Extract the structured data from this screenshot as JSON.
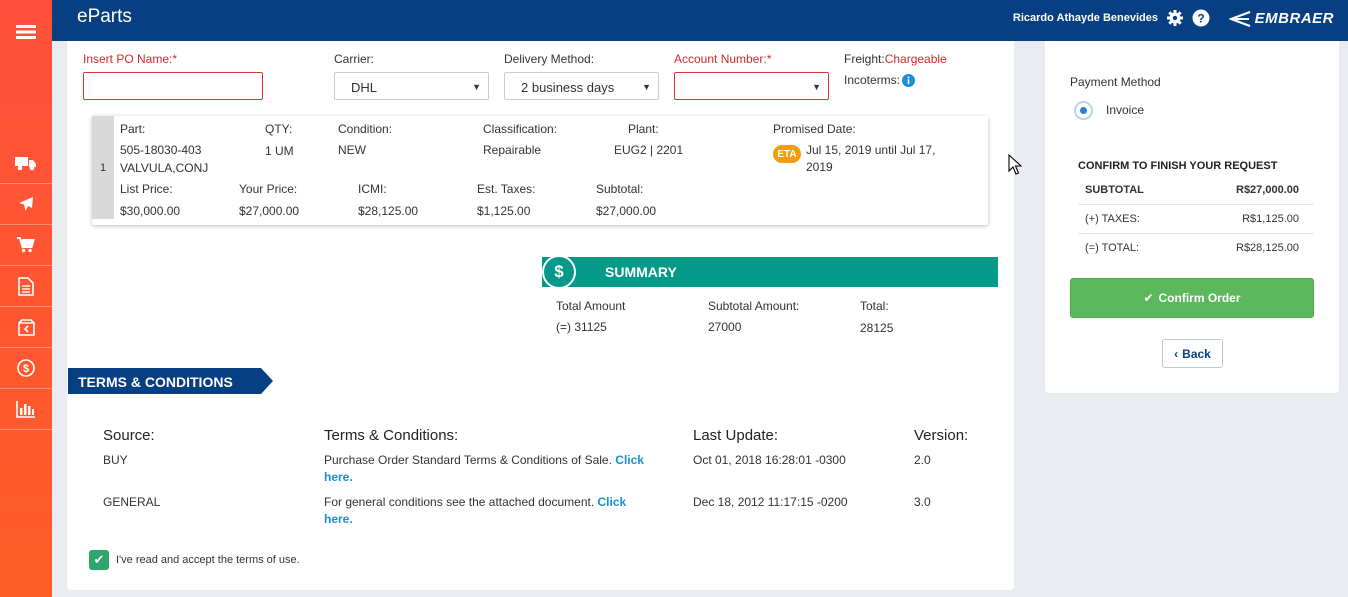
{
  "header": {
    "brand": "eParts",
    "user_name": "Ricardo Athayde Benevides",
    "logo_text": "EMBRAER",
    "icons": [
      "gear-icon",
      "help-icon"
    ]
  },
  "sidebar": {
    "items": [
      {
        "icon": "menu-icon"
      },
      {
        "icon": "truck-icon"
      },
      {
        "icon": "airplane-icon"
      },
      {
        "icon": "cart-icon"
      },
      {
        "icon": "document-icon"
      },
      {
        "icon": "return-box-icon"
      },
      {
        "icon": "dollar-cycle-icon"
      },
      {
        "icon": "bar-chart-icon"
      }
    ]
  },
  "form": {
    "po_name_label": "Insert PO Name:",
    "required_mark": "*",
    "po_name_value": "",
    "carrier_label": "Carrier:",
    "carrier_value": "DHL",
    "delivery_label": "Delivery Method:",
    "delivery_value": "2 business days",
    "account_label": "Account Number:",
    "account_value": "",
    "freight_label": "Freight:",
    "freight_value": "Chargeable",
    "incoterms_label": "Incoterms:"
  },
  "part": {
    "index": "1",
    "part_label": "Part:",
    "part_number": "505-18030-403",
    "part_name": "VALVULA,CONJ",
    "qty_label": "QTY:",
    "qty_value": "1 UM",
    "condition_label": "Condition:",
    "condition_value": "NEW",
    "classification_label": "Classification:",
    "classification_value": "Repairable",
    "plant_label": "Plant:",
    "plant_value": "EUG2 | 2201",
    "promised_label": "Promised Date:",
    "eta_badge": "ETA",
    "promised_line1": "Jul 15, 2019 until Jul 17,",
    "promised_line2": "2019",
    "list_price_label": "List Price:",
    "list_price_value": "$30,000.00",
    "your_price_label": "Your Price:",
    "your_price_value": "$27,000.00",
    "icmi_label": "ICMI:",
    "icmi_value": "$28,125.00",
    "taxes_label": "Est. Taxes:",
    "taxes_value": "$1,125.00",
    "subtotal_label": "Subtotal:",
    "subtotal_value": "$27,000.00"
  },
  "summary": {
    "icon_symbol": "$",
    "title": "SUMMARY",
    "total_amount_label": "Total Amount",
    "total_amount_value": "(=) 31125",
    "subtotal_amount_label": "Subtotal Amount:",
    "subtotal_amount_value": "27000",
    "total_label": "Total:",
    "total_value": "28125"
  },
  "terms": {
    "title": "TERMS & CONDITIONS",
    "headers": {
      "source": "Source:",
      "terms": "Terms & Conditions:",
      "last_update": "Last Update:",
      "version": "Version:"
    },
    "rows": [
      {
        "source": "BUY",
        "text": "Purchase Order Standard Terms & Conditions of Sale.",
        "link1": "Click",
        "link2": "here.",
        "updated": "Oct 01, 2018 16:28:01 -0300",
        "version": "2.0"
      },
      {
        "source": "GENERAL",
        "text": "For general conditions see the attached document.",
        "link1": "Click",
        "link2": "here.",
        "updated": "Dec 18, 2012 11:17:15 -0200",
        "version": "3.0"
      }
    ],
    "accept_label": "I've read and accept the terms of use.",
    "accepted": true
  },
  "checkout": {
    "payment_method_label": "Payment Method",
    "payment_option": "Invoice",
    "confirm_title": "CONFIRM TO FINISH YOUR REQUEST",
    "subtotal_label": "SUBTOTAL",
    "subtotal_value": "R$27,000.00",
    "taxes_label": "(+) TAXES:",
    "taxes_value": "R$1,125.00",
    "total_label": "(=) TOTAL:",
    "total_value": "R$28,125.00",
    "confirm_button": "Confirm Order",
    "back_button": "Back"
  },
  "colors": {
    "header": "#073f82",
    "sidebar": "#ff5533",
    "summary": "#05998a",
    "confirm": "#5cb85c",
    "required": "#d02a2a",
    "link": "#1a8fd6",
    "eta": "#f29c11"
  }
}
